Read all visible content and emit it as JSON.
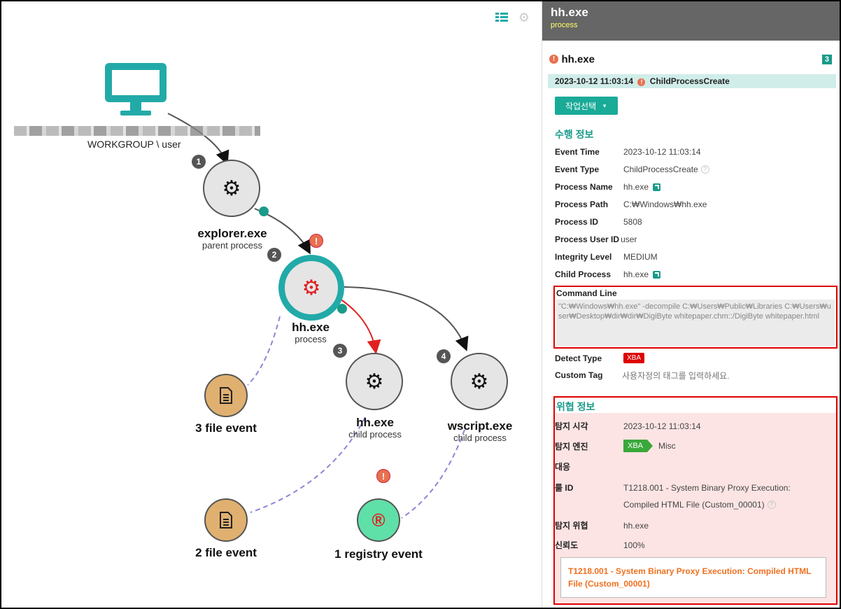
{
  "graph": {
    "host_label": "WORKGROUP \\ user",
    "nodes": {
      "explorer": {
        "name": "explorer.exe",
        "sub": "parent process"
      },
      "hh": {
        "name": "hh.exe",
        "sub": "process"
      },
      "hh_child": {
        "name": "hh.exe",
        "sub": "child process"
      },
      "wscript": {
        "name": "wscript.exe",
        "sub": "child process"
      },
      "file3": {
        "name": "3 file event"
      },
      "file2": {
        "name": "2 file event"
      },
      "registry": {
        "name": "1 registry event"
      }
    },
    "steps": [
      "1",
      "2",
      "3",
      "4"
    ],
    "warn_glyph": "!",
    "colors": {
      "teal": "#22aaa8",
      "red": "#e02020",
      "file": "#e0b070",
      "registry": "#5fe0a8"
    }
  },
  "panel": {
    "title": "hh.exe",
    "subtitle": "process",
    "item_title": "hh.exe",
    "item_count": "3",
    "event_time": "2023-10-12 11:03:14",
    "event_type": "ChildProcessCreate",
    "action_button": "작업선택",
    "exec_section": "수행 정보",
    "fields": [
      {
        "key": "Event Time",
        "value": "2023-10-12 11:03:14"
      },
      {
        "key": "Event Type",
        "value": "ChildProcessCreate"
      },
      {
        "key": "Process Name",
        "value": "hh.exe"
      },
      {
        "key": "Process Path",
        "value": "C:₩Windows₩hh.exe"
      },
      {
        "key": "Process ID",
        "value": "5808"
      },
      {
        "key": "Process User ID",
        "value": "user"
      },
      {
        "key": "Integrity Level",
        "value": "MEDIUM"
      },
      {
        "key": "Child Process",
        "value": "hh.exe"
      }
    ],
    "command_line_label": "Command Line",
    "command_line": "\"C:₩Windows₩hh.exe\" -decompile C:₩Users₩Public₩Libraries C:₩Users₩user₩Desktop₩dir₩dir₩DigiByte whitepaper.chm::/DigiByte whitepaper.html",
    "detect_type_label": "Detect Type",
    "detect_type": "XBA",
    "custom_tag_label": "Custom Tag",
    "custom_tag_placeholder": "사용자정의 태그를 입력하세요.",
    "threat_section": "위협 정보",
    "threat_fields": {
      "detect_time_label": "탐지 시각",
      "detect_time": "2023-10-12 11:03:14",
      "engine_label": "탐지 엔진",
      "engine_badge": "XBA",
      "engine_value": "Misc",
      "response_label": "대응",
      "rule_label": "룰 ID",
      "rule_line1": "T1218.001 - System Binary Proxy Execution:",
      "rule_line2": "Compiled HTML File (Custom_00001)",
      "threat_label": "탐지 위협",
      "threat_value": "hh.exe",
      "confidence_label": "신뢰도",
      "confidence_value": "100%"
    },
    "threat_box": "T1218.001 - System Binary Proxy Execution: Compiled HTML File (Custom_00001)"
  }
}
